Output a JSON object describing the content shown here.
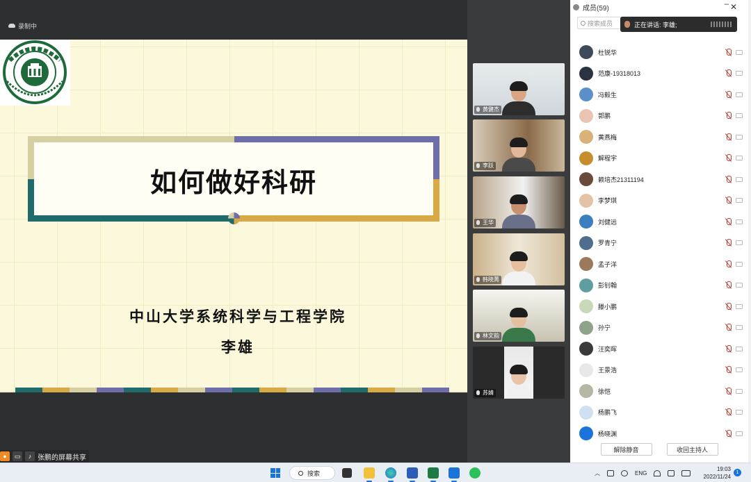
{
  "recording": {
    "label": "录制中"
  },
  "slide": {
    "title": "如何做好科研",
    "subtitle_line1": "中山大学系统科学与工程学院",
    "subtitle_line2": "李雄",
    "logo_text": "SUN YAT-SEN UNIVERSITY",
    "logo_chars": "中山大學",
    "colors": {
      "cream": "#d6cfa1",
      "purple": "#6e6fa8",
      "teal": "#1f6a6a",
      "gold": "#d9a946"
    }
  },
  "share_status": {
    "label": "张鹏的屏幕共享"
  },
  "videos": [
    {
      "name": "黄健杰"
    },
    {
      "name": "李跃"
    },
    {
      "name": "王华"
    },
    {
      "name": "韩晓菁"
    },
    {
      "name": "林文韵"
    },
    {
      "name": "苏婧"
    }
  ],
  "panel": {
    "title": "成员(59)",
    "search_placeholder": "搜索成员",
    "speaking_label": "正在讲话: 李雄;",
    "members": [
      {
        "name": "杜锐华",
        "avatar_color": "#3c4a5a"
      },
      {
        "name": "范康-19318013",
        "avatar_color": "#2b3340"
      },
      {
        "name": "冯毅生",
        "avatar_color": "#5b8fc9"
      },
      {
        "name": "郭鹏",
        "avatar_color": "#e9c4b3"
      },
      {
        "name": "黄燕梅",
        "avatar_color": "#d9b27a"
      },
      {
        "name": "解程宇",
        "avatar_color": "#c78d2c"
      },
      {
        "name": "赖培杰21311194",
        "avatar_color": "#6a4a3a"
      },
      {
        "name": "李梦琪",
        "avatar_color": "#e4c2a5"
      },
      {
        "name": "刘健远",
        "avatar_color": "#3a7fc0"
      },
      {
        "name": "罗青宁",
        "avatar_color": "#4f6e8f"
      },
      {
        "name": "孟子洋",
        "avatar_color": "#9a7a5a"
      },
      {
        "name": "彭钊翰",
        "avatar_color": "#5f9ea0"
      },
      {
        "name": "滕小鹏",
        "avatar_color": "#c8d8b8"
      },
      {
        "name": "孙宁",
        "avatar_color": "#8fa28a"
      },
      {
        "name": "汪奕晖",
        "avatar_color": "#3a3a3a"
      },
      {
        "name": "王景浩",
        "avatar_color": "#e8e8e8"
      },
      {
        "name": "徐恺",
        "avatar_color": "#b6b6a4"
      },
      {
        "name": "杨鹏飞",
        "avatar_color": "#cfe0f0"
      },
      {
        "name": "杨晓渊",
        "avatar_color": "#1a73d9"
      }
    ],
    "unmute_button": "解除静音",
    "reclaim_host_button": "收回主持人"
  },
  "taskbar": {
    "search_label": "搜索",
    "lang": "ENG",
    "time": "19:03",
    "date": "2022/11/24",
    "notifications": "1"
  }
}
